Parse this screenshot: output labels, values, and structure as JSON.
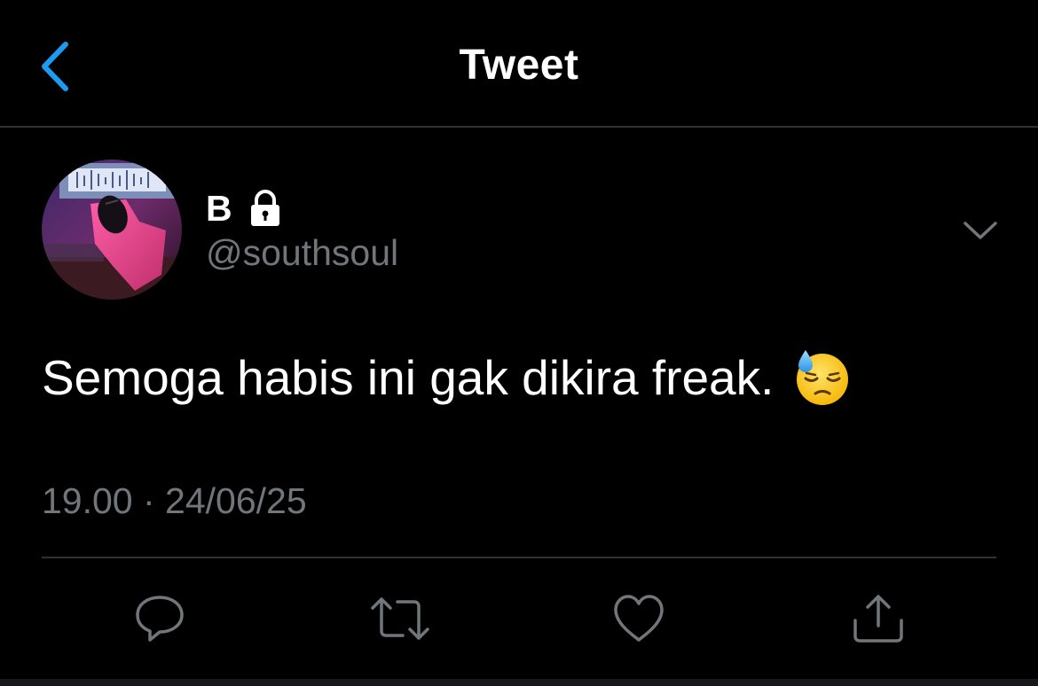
{
  "header": {
    "back_icon": "chevron-left-icon",
    "title": "Tweet"
  },
  "author": {
    "name": "B",
    "handle": "@southsoul",
    "protected_icon": "lock-icon",
    "avatar_icon": "avatar-photo",
    "more_icon": "chevron-down-icon"
  },
  "tweet": {
    "text": "Semoga habis ini gak dikira freak.",
    "emoji": "downcast-face-with-sweat-emoji",
    "timestamp": "19.00 · 24/06/25"
  },
  "actions": {
    "reply_icon": "reply-icon",
    "retweet_icon": "retweet-icon",
    "like_icon": "heart-icon",
    "share_icon": "share-icon"
  },
  "colors": {
    "background": "#000000",
    "accent": "#1d9bf0",
    "primary_text": "#ffffff",
    "secondary_text": "#71767b",
    "divider": "#2f3336"
  }
}
